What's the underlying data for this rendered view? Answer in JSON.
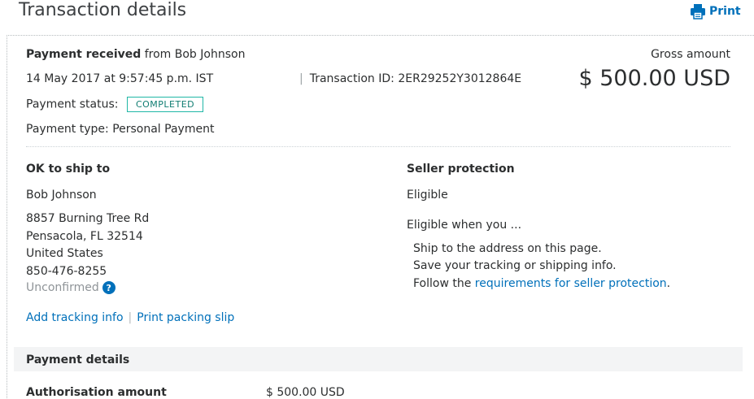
{
  "header": {
    "title": "Transaction details",
    "print_label": "Print"
  },
  "summary": {
    "payment_received_label": "Payment received",
    "from_text": "from Bob Johnson",
    "datetime": "14 May 2017 at 9:57:45 p.m. IST",
    "transaction_id_label": "Transaction ID:",
    "transaction_id": "2ER29252Y3012864E",
    "status_label": "Payment status:",
    "status_value": "COMPLETED",
    "type_label": "Payment type:",
    "type_value": "Personal Payment",
    "gross_label": "Gross amount",
    "gross_amount": "$ 500.00 USD"
  },
  "shipping": {
    "heading": "OK to ship to",
    "name": "Bob Johnson",
    "address_line1": "8857 Burning Tree Rd",
    "address_line2": "Pensacola, FL 32514",
    "country": "United States",
    "phone": "850-476-8255",
    "address_status": "Unconfirmed",
    "help_icon_glyph": "?",
    "add_tracking_label": "Add tracking info",
    "print_packing_label": "Print packing slip"
  },
  "seller_protection": {
    "heading": "Seller protection",
    "status": "Eligible",
    "intro": "Eligible when you ...",
    "items": [
      "Ship to the address on this page.",
      "Save your tracking or shipping info."
    ],
    "follow_prefix": "Follow the",
    "requirements_link": "requirements for seller protection",
    "follow_suffix": "."
  },
  "payment_details": {
    "heading": "Payment details",
    "authorisation_label": "Authorisation amount",
    "authorisation_value": "$ 500.00 USD"
  },
  "colors": {
    "link": "#0070ba",
    "badge_border": "#20b7a6",
    "text": "#2c2e2f"
  },
  "icons": {
    "print": "printer-icon",
    "help": "question-circle-icon"
  }
}
